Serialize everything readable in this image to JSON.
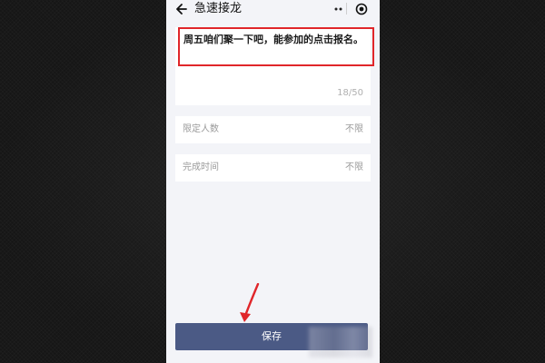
{
  "header": {
    "title": "急速接龙"
  },
  "content": {
    "text": "周五咱们聚一下吧，能参加的点击报名。",
    "counter": "18/50"
  },
  "fields": [
    {
      "label": "限定人数",
      "value": "不限"
    },
    {
      "label": "完成时间",
      "value": "不限"
    }
  ],
  "footer": {
    "save_label": "保存"
  },
  "colors": {
    "phone_background": "#f3f4f8",
    "save_button": "#4b5a85",
    "highlight": "#e0262a"
  }
}
